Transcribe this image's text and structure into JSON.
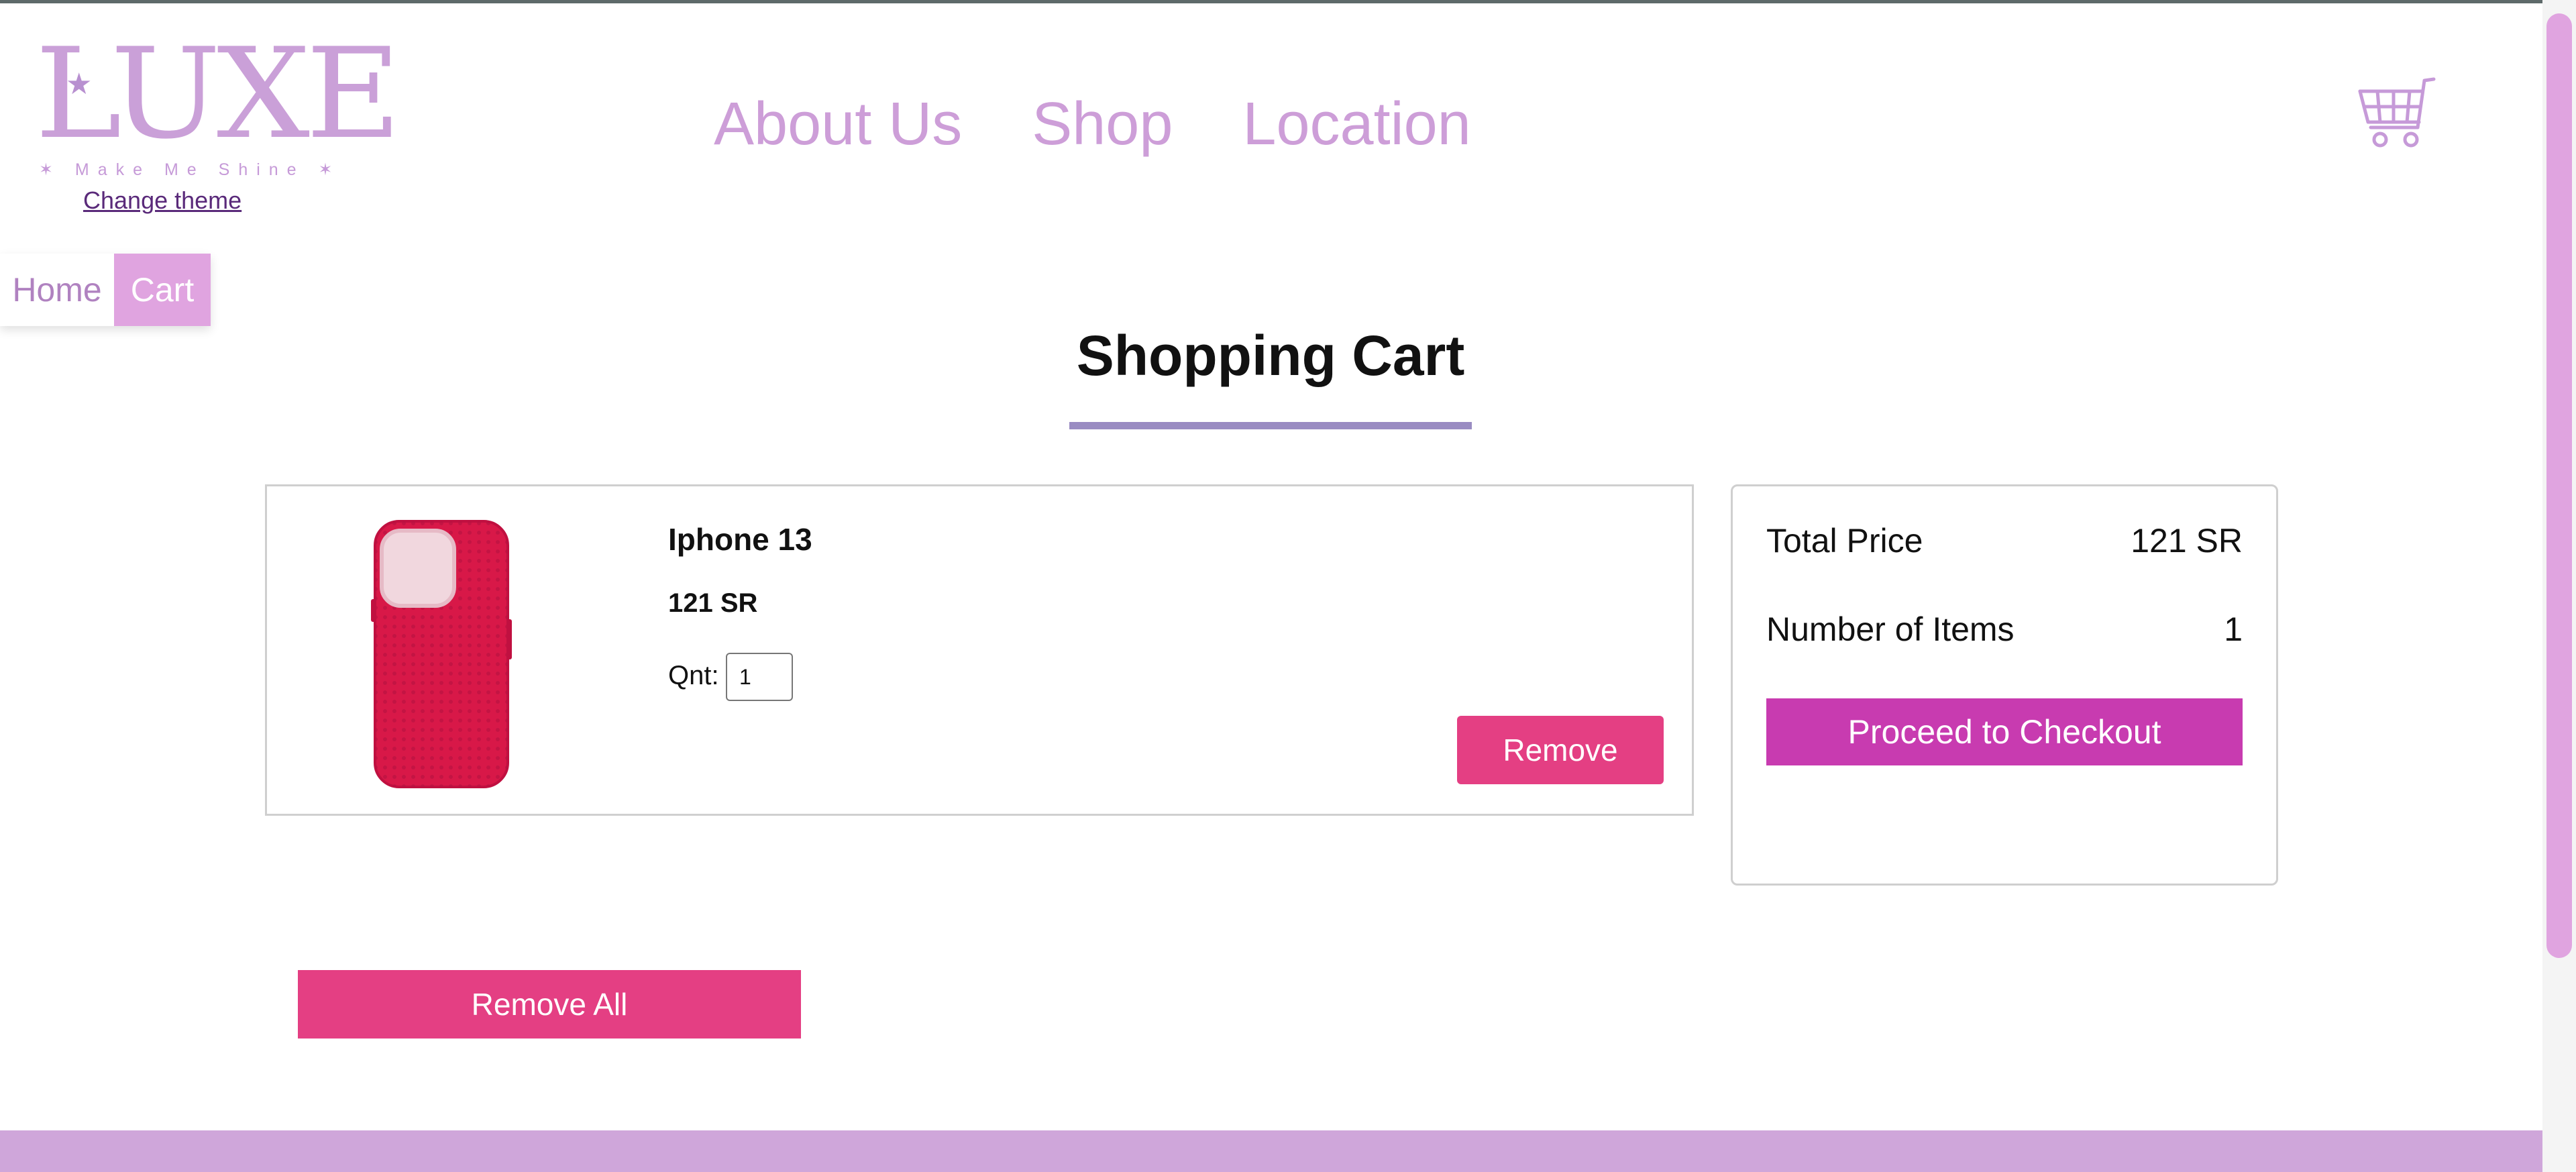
{
  "brand": {
    "logo_text": "LUXE",
    "tagline": "✶ Make Me Shine ✶",
    "change_theme_label": "Change theme"
  },
  "nav": {
    "items": [
      {
        "label": "About Us"
      },
      {
        "label": "Shop"
      },
      {
        "label": "Location"
      }
    ]
  },
  "header": {
    "cart_icon": "shopping-cart-icon"
  },
  "breadcrumb": {
    "home_label": "Home",
    "cart_label": "Cart"
  },
  "page": {
    "title": "Shopping Cart"
  },
  "cart": {
    "items": [
      {
        "name": "Iphone 13",
        "price": "121 SR",
        "qnt_label": "Qnt:",
        "quantity": "1",
        "remove_label": "Remove",
        "image_icon": "phone-case-image"
      }
    ],
    "remove_all_label": "Remove All"
  },
  "summary": {
    "total_price_label": "Total Price",
    "total_price_value": "121 SR",
    "items_label": "Number of Items",
    "items_value": "1",
    "checkout_label": "Proceed to Checkout"
  },
  "colors": {
    "brand_lilac": "#cd9ed8",
    "accent_pink": "#e43f83",
    "checkout_magenta": "#c83bb0",
    "breadcrumb_active": "#e0a4e0",
    "title_underline": "#9a8cc2",
    "footer": "#cfa6da"
  }
}
